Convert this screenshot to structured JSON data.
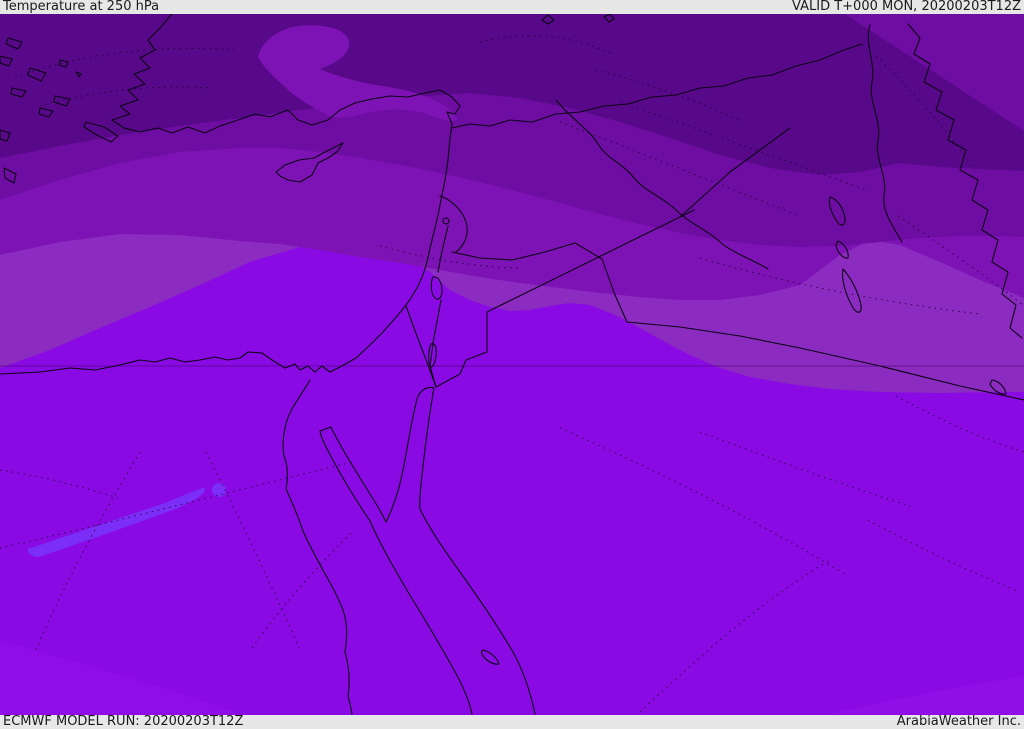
{
  "header": {
    "title": "Temperature at 250 hPa",
    "valid": "VALID T+000 MON, 20200203T12Z"
  },
  "footer": {
    "model_run": "ECMWF MODEL RUN: 20200203T12Z",
    "provider": "ArabiaWeather Inc."
  },
  "map": {
    "region": "Middle East / Eastern Mediterranean",
    "bands_note": "temperature shading bands, coldest (dark purple) in north to warmest (bright violet) in south",
    "colors": {
      "band1_coldest": "#570989",
      "band2": "#6e0da2",
      "band3": "#7e13b5",
      "band4": "#8b2bc0",
      "band5_warm": "#8a0ae3",
      "band6_blob": "#7b2ef6",
      "bottom_accent": "#9a12ea",
      "coastline": "#0d0016",
      "contour_dots": "#1c0030",
      "latitude_line": "#43006e",
      "bar_background": "#e7e7e7",
      "bar_text": "#1a1a1a"
    }
  }
}
